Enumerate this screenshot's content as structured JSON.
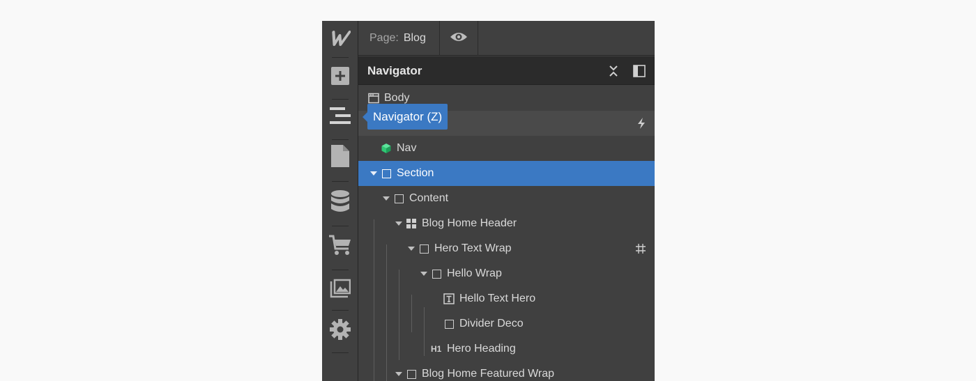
{
  "topbar": {
    "page_label": "Page:",
    "page_name": "Blog",
    "preview_icon": "eye-icon"
  },
  "rail": {
    "logo_icon": "webflow-logo",
    "items": [
      {
        "icon": "add-icon"
      },
      {
        "icon": "navigator-icon"
      },
      {
        "icon": "pages-icon"
      },
      {
        "icon": "cms-database-icon"
      },
      {
        "icon": "ecommerce-cart-icon"
      },
      {
        "icon": "assets-icon"
      },
      {
        "icon": "settings-gear-icon"
      }
    ]
  },
  "navigator": {
    "title": "Navigator",
    "collapse_icon": "collapse-all-icon",
    "dock_icon": "dock-panel-icon",
    "tooltip": "Navigator (Z)",
    "tree": [
      {
        "label": "Body",
        "icon": "body-icon"
      },
      {
        "label": "",
        "icon": "interaction-bolt-icon"
      },
      {
        "label": "Nav",
        "icon": "symbol-cube-icon"
      },
      {
        "label": "Section",
        "icon": "box-icon",
        "selected": true
      },
      {
        "label": "Content",
        "icon": "box-icon"
      },
      {
        "label": "Blog Home Header",
        "icon": "grid-icon"
      },
      {
        "label": "Hero Text Wrap",
        "icon": "box-icon",
        "badge_icon": "hash-id-icon"
      },
      {
        "label": "Hello Wrap",
        "icon": "box-icon"
      },
      {
        "label": "Hello Text Hero",
        "icon": "text-block-icon"
      },
      {
        "label": "Divider Deco",
        "icon": "box-icon"
      },
      {
        "label": "Hero Heading",
        "icon": "heading-h1-icon",
        "tag": "H1"
      },
      {
        "label": "Blog Home Featured Wrap",
        "icon": "box-icon"
      }
    ]
  },
  "colors": {
    "selection": "#3b79c3",
    "symbol": "#2fc874",
    "panel_bg": "#404040"
  }
}
